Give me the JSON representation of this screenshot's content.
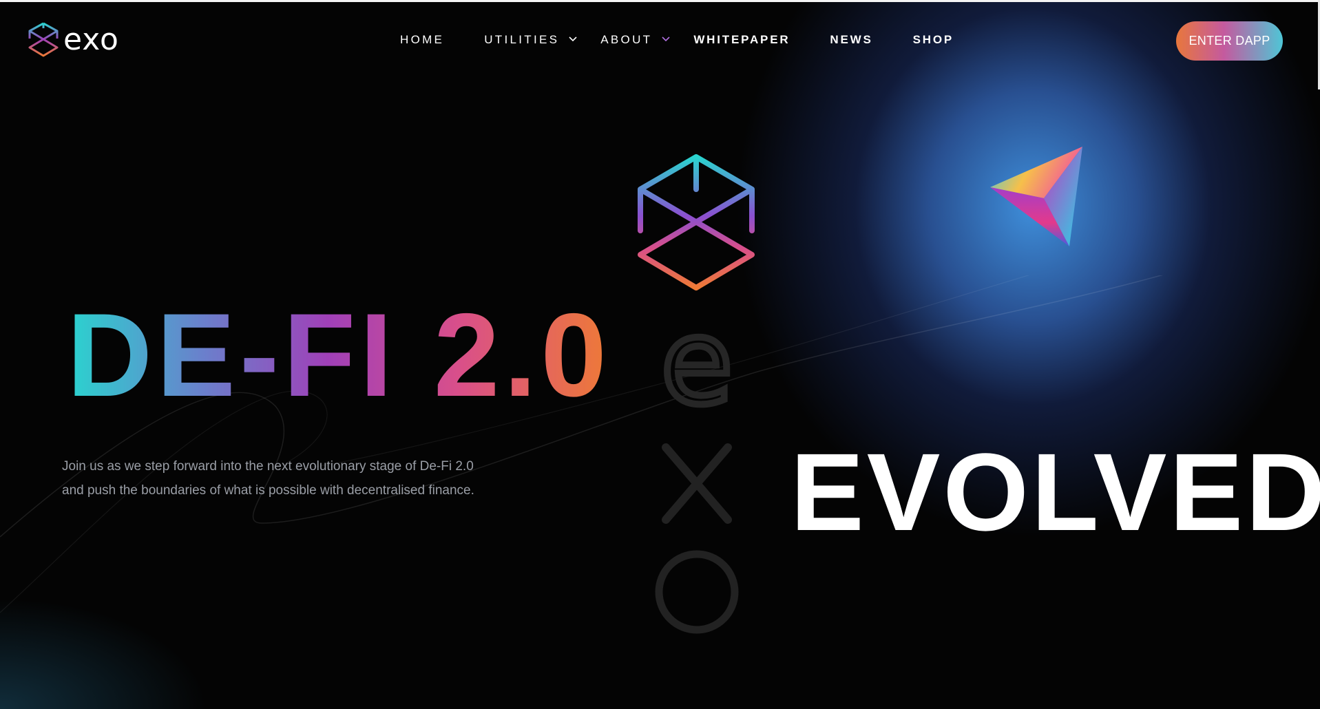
{
  "brand": {
    "name": "exo"
  },
  "nav": {
    "items": [
      {
        "label": "HOME",
        "has_dropdown": false
      },
      {
        "label": "UTILITIES",
        "has_dropdown": true
      },
      {
        "label": "ABOUT",
        "has_dropdown": true
      },
      {
        "label": "WHITEPAPER",
        "has_dropdown": false
      },
      {
        "label": "NEWS",
        "has_dropdown": false
      },
      {
        "label": "SHOP",
        "has_dropdown": false
      }
    ],
    "cta_label": "ENTER DAPP"
  },
  "hero": {
    "title": "DE-FI 2.0",
    "description_line1": "Join us as we step forward into the next evolutionary stage of De-Fi 2.0",
    "description_line2": "and push the boundaries of what is possible with decentralised finance.",
    "vertical_word": "exo",
    "tagline": "EVOLVED"
  },
  "colors": {
    "gradient_start": "#2ad4cf",
    "gradient_mid": "#a040b8",
    "gradient_end": "#ee7a36",
    "glow_blue": "#4296e6",
    "background": "#040404"
  },
  "icons": [
    "exo-logo-icon",
    "chevron-down-icon",
    "cube-icon",
    "pyramid-icon"
  ]
}
